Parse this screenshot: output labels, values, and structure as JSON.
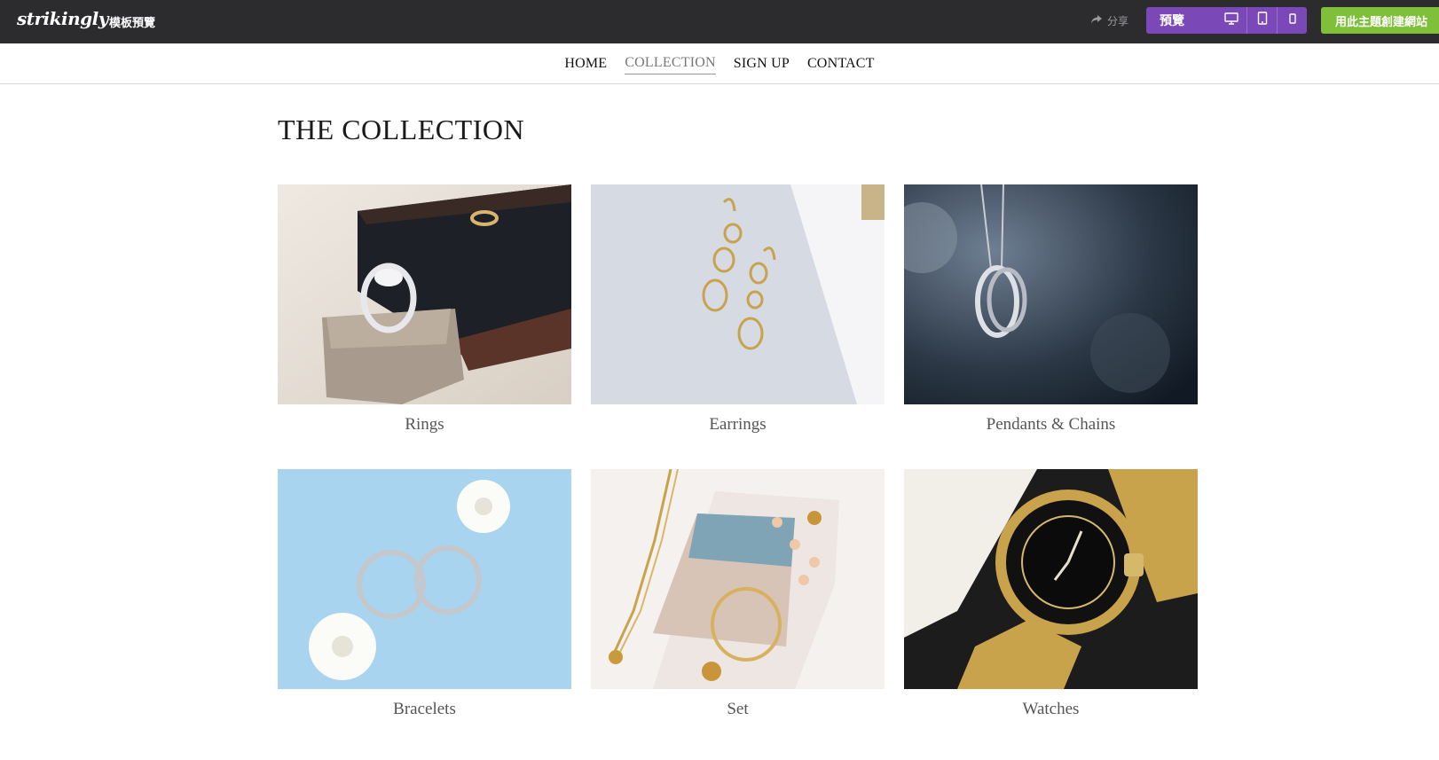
{
  "toolbar": {
    "brand": "strikingly",
    "subtitle": "模板預覽",
    "share_label": "分享",
    "preview_label": "預覽",
    "create_label": "用此主題創建網站",
    "icons": [
      "share-icon",
      "desktop-icon",
      "tablet-icon",
      "mobile-icon"
    ],
    "colors": {
      "bar": "#2c2c2e",
      "preview": "#7b48b8",
      "create": "#7fbf3a"
    }
  },
  "nav": {
    "items": [
      {
        "label": "HOME",
        "active": false
      },
      {
        "label": "COLLECTION",
        "active": true
      },
      {
        "label": "SIGN UP",
        "active": false
      },
      {
        "label": "CONTACT",
        "active": false
      }
    ]
  },
  "main": {
    "title": "THE COLLECTION",
    "cards": [
      {
        "label": "Rings",
        "image": "ring in velvet box"
      },
      {
        "label": "Earrings",
        "image": "gold drop earrings"
      },
      {
        "label": "Pendants & Chains",
        "image": "silver ring pendant on chain"
      },
      {
        "label": "Bracelets",
        "image": "silver hoop bracelets with white flowers"
      },
      {
        "label": "Set",
        "image": "gold jewelry set with photo"
      },
      {
        "label": "Watches",
        "image": "gold dive watch"
      }
    ]
  }
}
